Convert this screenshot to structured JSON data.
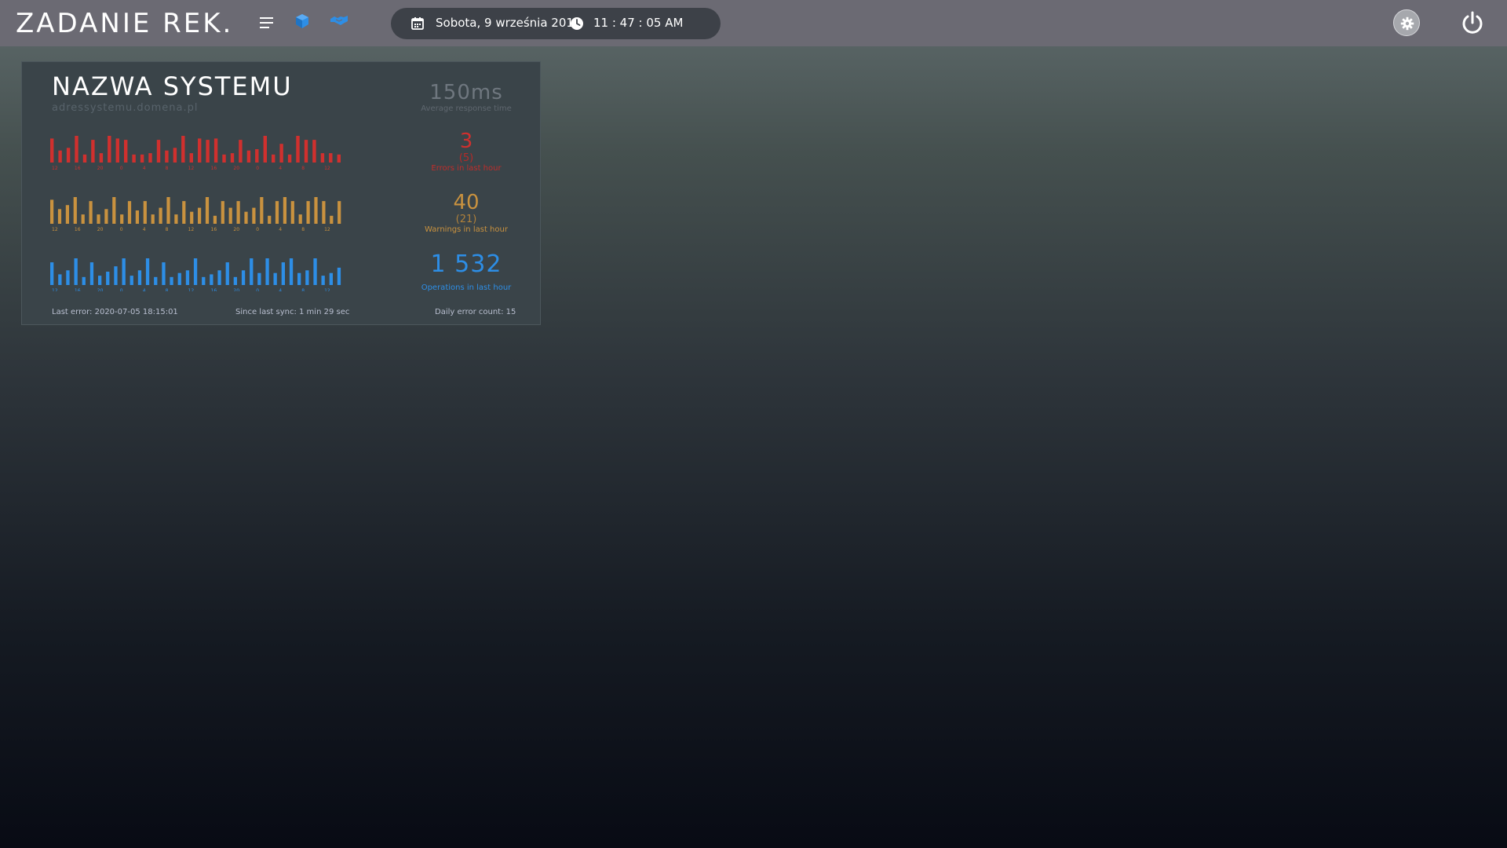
{
  "header": {
    "title": "ZADANIE REK.",
    "date": "Sobota, 9 września 2019",
    "time": "11 : 47 : 05 AM",
    "icons": [
      "menu-icon",
      "cube-icon",
      "handshake-icon",
      "calendar-icon",
      "clock-icon",
      "gear-icon",
      "power-icon"
    ]
  },
  "card": {
    "name": "NAZWA SYSTEMU",
    "url": "adressystemu.domena.pl",
    "response": {
      "value": "150ms",
      "label": "Average response time"
    },
    "errors": {
      "value": "3",
      "sub": "(5)",
      "label": "Errors in last hour",
      "color": "#d0302e"
    },
    "warnings": {
      "value": "40",
      "sub": "(21)",
      "label": "Warnings in last hour",
      "color": "#c9923f"
    },
    "operations": {
      "value": "1 532",
      "label": "Operations in last hour",
      "color": "#2d8ee6"
    },
    "footer": {
      "last_error": "Last error: 2020-07-05 18:15:01",
      "since_sync": "Since last sync: 1 min 29 sec",
      "daily_errors": "Daily error count: 15"
    }
  },
  "chart_data": [
    {
      "type": "bar",
      "series": [
        {
          "values": [
            0.9,
            0.45,
            0.55,
            1.0,
            0.3,
            0.85,
            0.35,
            1.0,
            0.9,
            0.85,
            0.3,
            0.3,
            0.35,
            0.85,
            0.45,
            0.55,
            1.0,
            0.35,
            0.9,
            0.85,
            0.9,
            0.3,
            0.35,
            0.85,
            0.45,
            0.5,
            1.0,
            0.3,
            0.7,
            0.3,
            1.0,
            0.85,
            0.85,
            0.35,
            0.35,
            0.3
          ]
        }
      ],
      "tick_labels": [
        "12",
        "16",
        "20",
        "0",
        "4",
        "8",
        "12",
        "16",
        "20",
        "0",
        "4",
        "8",
        "12"
      ],
      "color": "#d0302e"
    },
    {
      "type": "bar",
      "series": [
        {
          "values": [
            0.9,
            0.55,
            0.7,
            1.0,
            0.35,
            0.85,
            0.35,
            0.55,
            1.0,
            0.35,
            0.85,
            0.5,
            0.85,
            0.35,
            0.6,
            1.0,
            0.35,
            0.85,
            0.45,
            0.6,
            1.0,
            0.3,
            0.85,
            0.6,
            0.85,
            0.45,
            0.6,
            1.0,
            0.3,
            0.85,
            1.0,
            0.85,
            0.35,
            0.85,
            1.0,
            0.85,
            0.3,
            0.85
          ]
        }
      ],
      "tick_labels": [
        "12",
        "16",
        "20",
        "0",
        "4",
        "8",
        "12",
        "16",
        "20",
        "0",
        "4",
        "8",
        "12"
      ],
      "color": "#c9923f"
    },
    {
      "type": "bar",
      "series": [
        {
          "values": [
            0.85,
            0.4,
            0.55,
            1.0,
            0.3,
            0.85,
            0.35,
            0.5,
            0.7,
            1.0,
            0.35,
            0.55,
            1.0,
            0.3,
            0.85,
            0.3,
            0.45,
            0.55,
            1.0,
            0.3,
            0.4,
            0.55,
            0.85,
            0.3,
            0.55,
            1.0,
            0.45,
            1.0,
            0.45,
            0.85,
            1.0,
            0.45,
            0.55,
            1.0,
            0.35,
            0.45,
            0.65
          ]
        }
      ],
      "tick_labels": [
        "12",
        "16",
        "20",
        "0",
        "4",
        "8",
        "12",
        "16",
        "20",
        "0",
        "4",
        "8",
        "12"
      ],
      "color": "#2d8ee6"
    }
  ]
}
